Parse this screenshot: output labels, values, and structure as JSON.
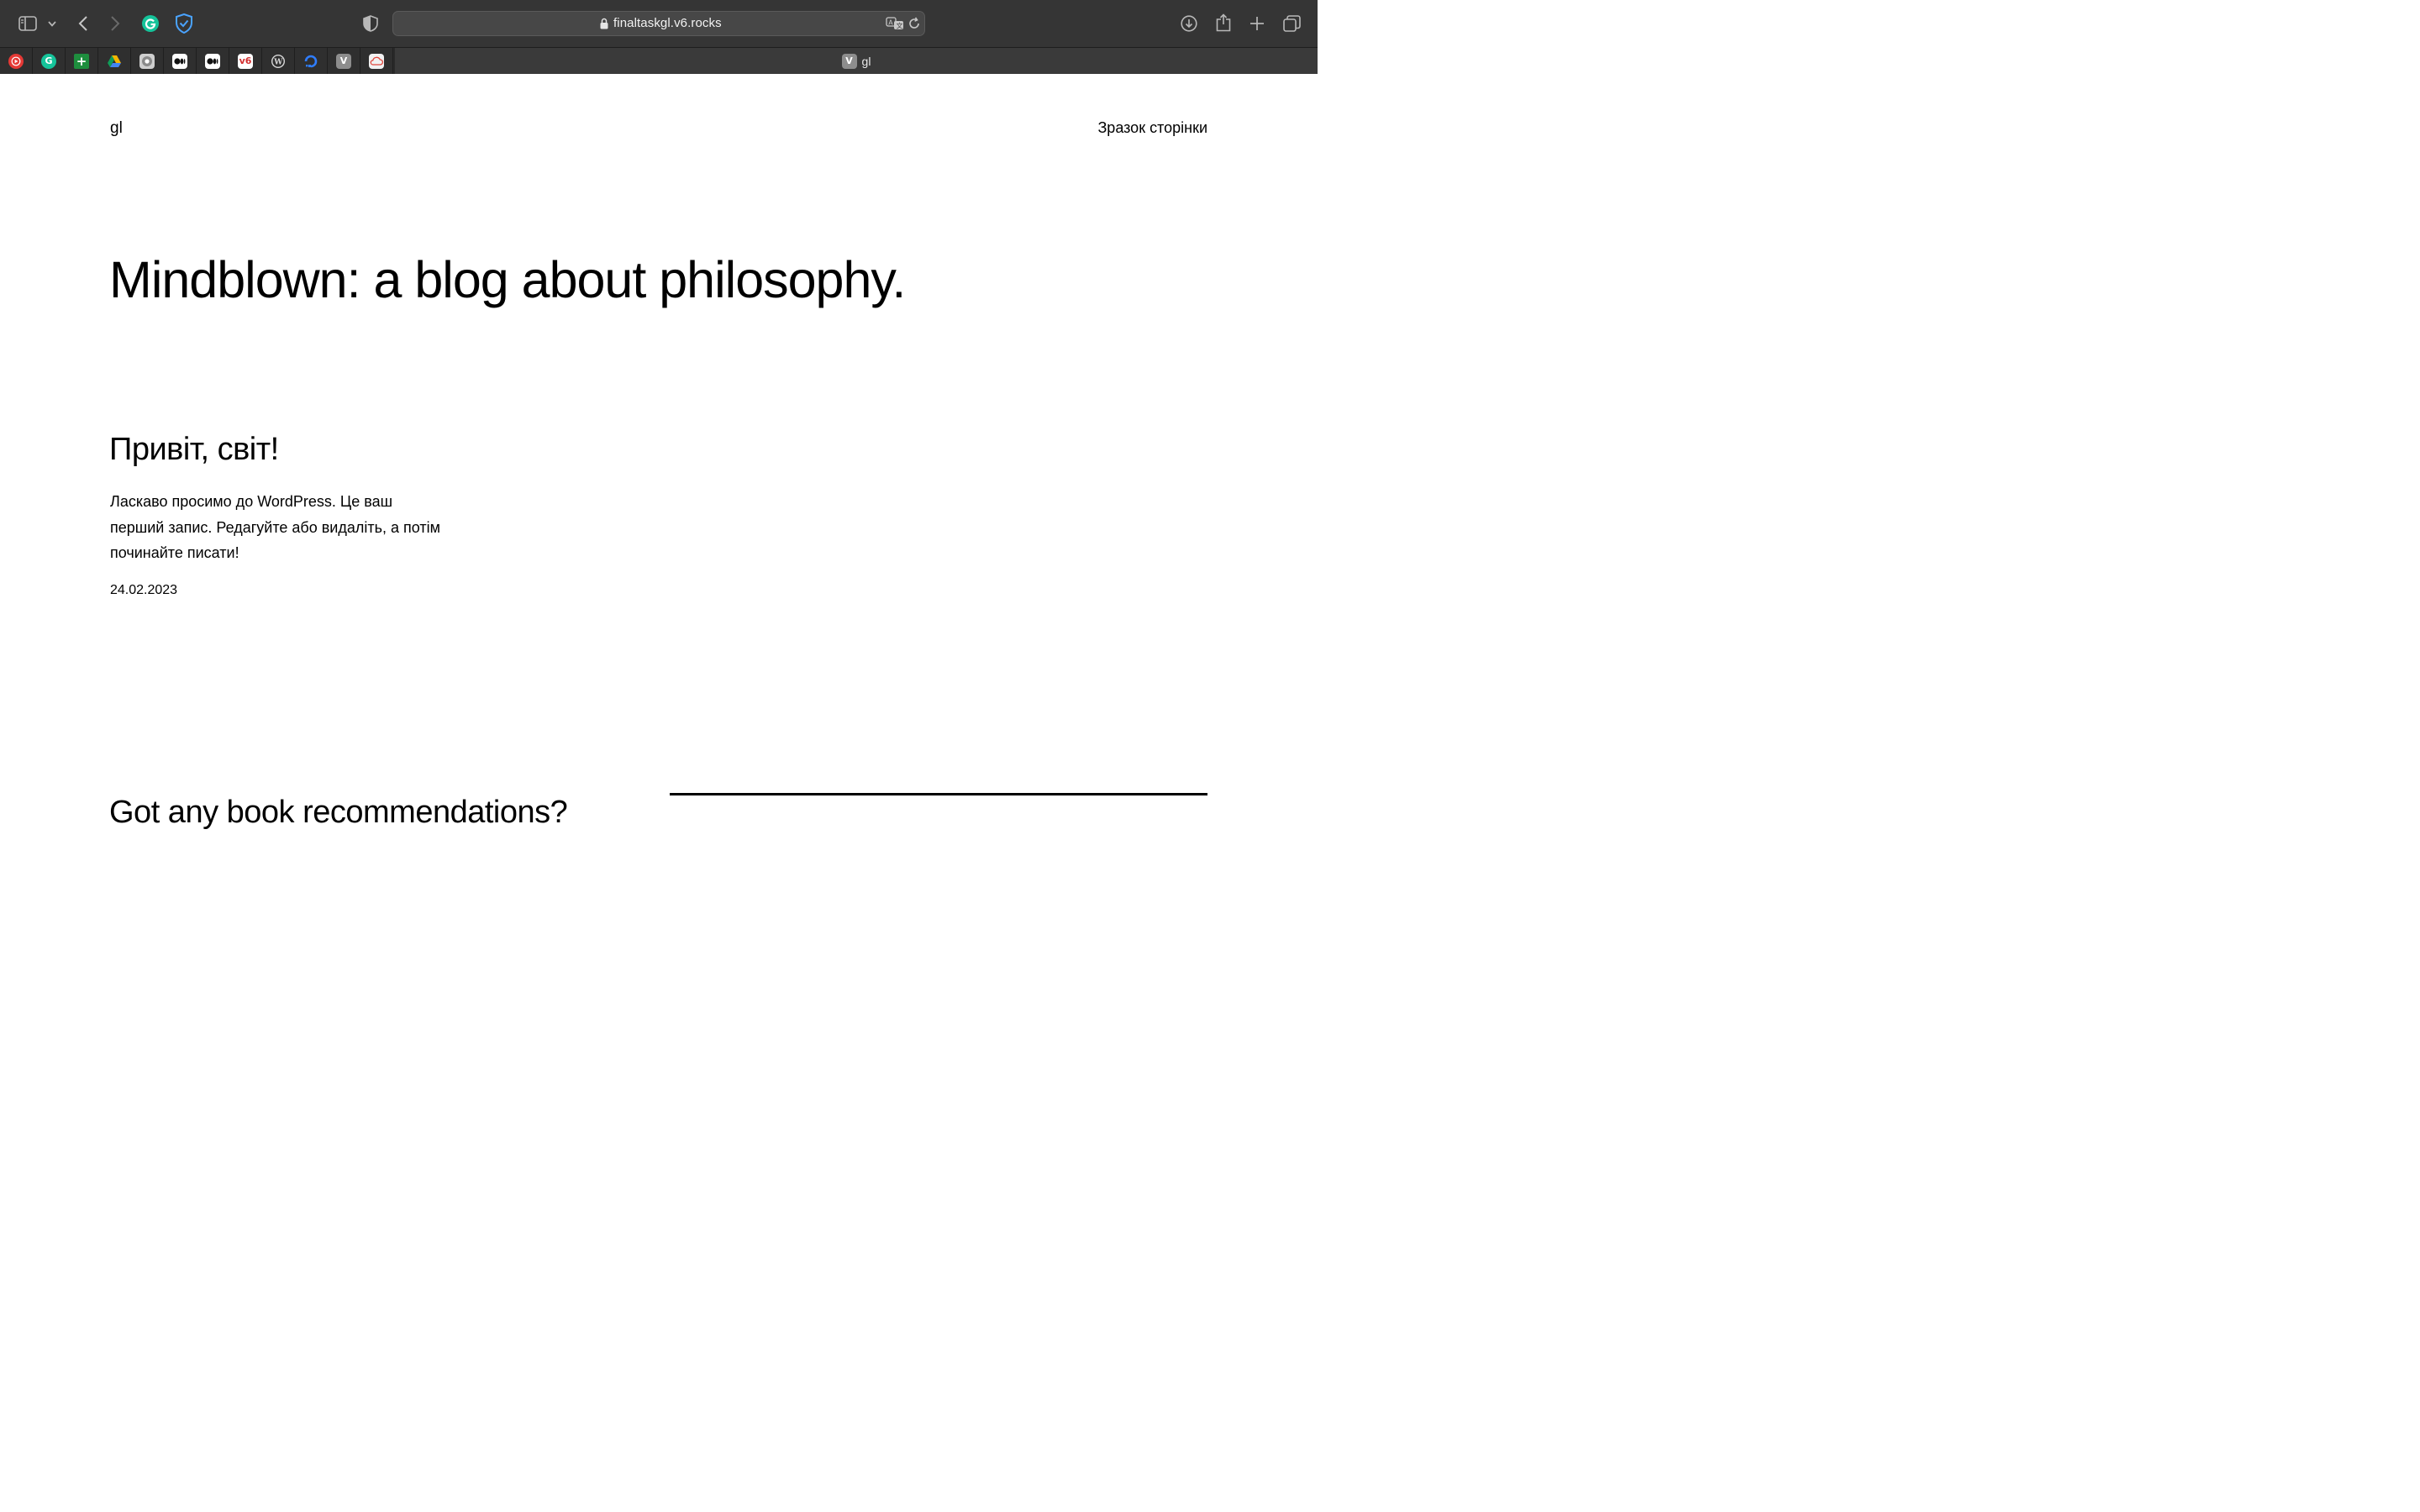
{
  "browser": {
    "url": "finaltaskgl.v6.rocks",
    "active_tab": {
      "title": "gl",
      "favicon_letter": "V"
    },
    "favorites": [
      {
        "name": "youtube-music",
        "color": "#e53935",
        "letter": ""
      },
      {
        "name": "grammarly",
        "color": "#15c39a",
        "letter": "G"
      },
      {
        "name": "google-sheets-plus",
        "color": "#1e8e3e",
        "letter": "+"
      },
      {
        "name": "google-drive",
        "color": "#f5b400",
        "letter": ""
      },
      {
        "name": "chromium",
        "color": "#9e9e9e",
        "letter": ""
      },
      {
        "name": "medium-1",
        "color": "#111111",
        "letter": "M"
      },
      {
        "name": "medium-2",
        "color": "#111111",
        "letter": "M"
      },
      {
        "name": "v6",
        "color": "#ffffff",
        "letter": "v6"
      },
      {
        "name": "wordpress",
        "color": "#d0d0d0",
        "letter": "W"
      },
      {
        "name": "digitalocean",
        "color": "#0069ff",
        "letter": ""
      },
      {
        "name": "v-site",
        "color": "#8d8d8d",
        "letter": "V"
      },
      {
        "name": "cloud",
        "color": "#ffffff",
        "letter": ""
      }
    ]
  },
  "site": {
    "title": "gl",
    "nav_sample_page": "Зразок сторінки"
  },
  "hero": {
    "heading": "Mindblown: a blog about philosophy."
  },
  "post": {
    "title": "Привіт, світ!",
    "excerpt": "Ласкаво просимо до WordPress. Це ваш перший запис. Редагуйте або видаліть, а потім починайте писати!",
    "date": "24.02.2023"
  },
  "cta": {
    "heading": "Got any book recommendations?"
  },
  "colors": {
    "toolbar_bg": "#353535",
    "tabsbar_bg": "#2a2a2a",
    "page_bg": "#ffffff",
    "text": "#000000"
  }
}
